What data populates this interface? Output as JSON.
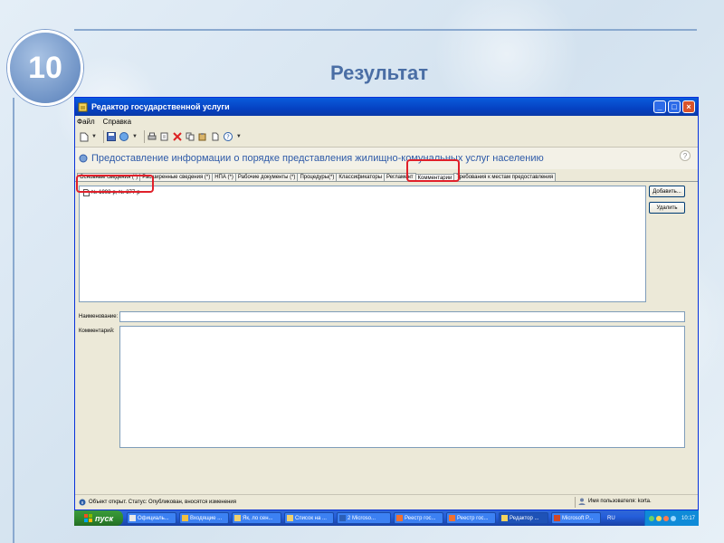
{
  "slide": {
    "number": "10",
    "title": "Результат"
  },
  "window": {
    "title": "Редактор государственной услуги",
    "menu": [
      "Файл",
      "Справка"
    ],
    "header_title": "Предоставление информации о порядке представления жилищно-комунальных услуг населению",
    "help_label": "?",
    "tabs": [
      {
        "label": "Основные сведения (*)"
      },
      {
        "label": "Расширенные сведения (*)"
      },
      {
        "label": "НПА (*)"
      },
      {
        "label": "Рабочие документы (*)"
      },
      {
        "label": "Процедуры(*)"
      },
      {
        "label": "Классификаторы"
      },
      {
        "label": "Регламент"
      },
      {
        "label": "Комментарии"
      },
      {
        "label": "Требования к местам предоставления"
      }
    ],
    "active_tab": "Комментарии",
    "list_items": [
      {
        "label": "№ 1993-р, № 377-р"
      }
    ],
    "buttons": {
      "add": "Добавить...",
      "delete": "Удалить"
    },
    "fields": {
      "name_label": "Наименование:",
      "name_value": "",
      "comment_label": "Комментарий:",
      "comment_value": ""
    },
    "status": {
      "text": "Объект открыт. Статус: Опубликован, вносятся изменения",
      "user": "Имя пользователя: korta."
    }
  },
  "taskbar": {
    "start_label": "пуск",
    "items": [
      {
        "label": "Официаль..."
      },
      {
        "label": "Входящие ..."
      },
      {
        "label": "Як, ло сен..."
      },
      {
        "label": "Список на ..."
      },
      {
        "label": "2 Microso..."
      },
      {
        "label": "Реестр гос..."
      },
      {
        "label": "Реестр гос..."
      },
      {
        "label": "Редактор ..."
      },
      {
        "label": "Microsoft P..."
      }
    ],
    "lang": "RU",
    "time": "10:17"
  },
  "colors": {
    "highlight": "#e0202a",
    "title_blue": "#4a6ea5",
    "xp_blue": "#0542c2"
  }
}
